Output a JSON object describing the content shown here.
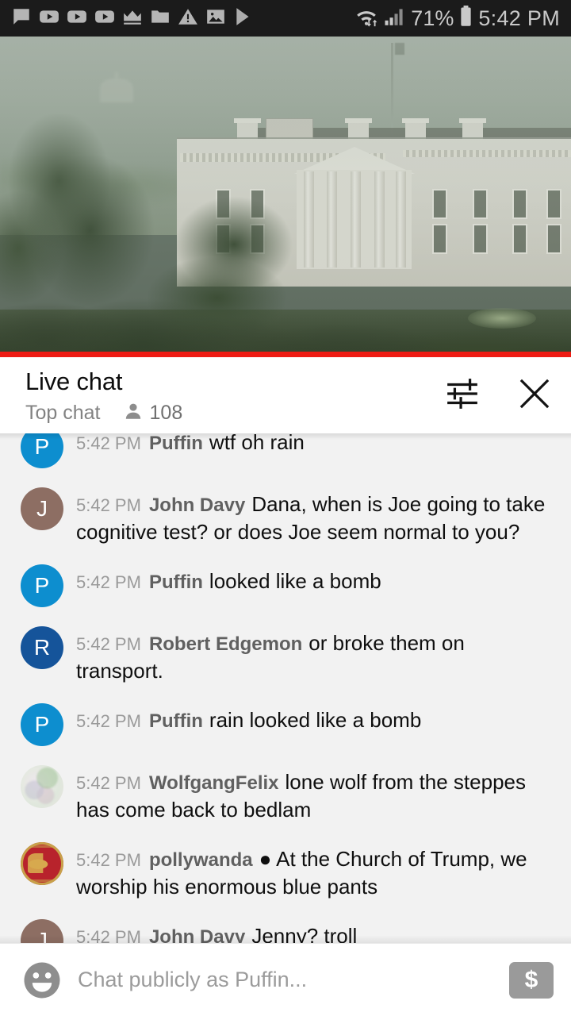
{
  "status_bar": {
    "icons_left": [
      "chat-bubble-icon",
      "youtube-icon",
      "youtube-icon",
      "youtube-icon",
      "crown-icon",
      "folder-icon",
      "warning-triangle-icon",
      "image-icon",
      "play-store-icon"
    ],
    "wifi_icon": "wifi-transfer-icon",
    "signal_icon": "cellular-signal-icon",
    "battery_percent": "71%",
    "battery_icon": "battery-icon",
    "clock": "5:42 PM",
    "background_color": "#1b1b1b",
    "foreground_color": "#c9c9c9"
  },
  "video": {
    "description": "White House live stream in hazy rain",
    "progress_bar_color": "#ee1b13",
    "progress_percent": 100
  },
  "chat_header": {
    "title": "Live chat",
    "mode": "Top chat",
    "viewer_count": "108",
    "viewer_icon": "person-icon",
    "settings_icon": "chat-settings-sliders-icon",
    "close_icon": "close-x-icon"
  },
  "messages": [
    {
      "time": "5:42 PM",
      "author": "Puffin",
      "text": "wtf oh rain",
      "avatar_type": "letter",
      "avatar_letter": "P",
      "avatar_color": "#0d8ecf",
      "clipped": true
    },
    {
      "time": "5:42 PM",
      "author": "John Davy",
      "text": "Dana, when is Joe going to take cognitive test? or does Joe seem normal to you?",
      "avatar_type": "letter",
      "avatar_letter": "J",
      "avatar_color": "#8d6e63"
    },
    {
      "time": "5:42 PM",
      "author": "Puffin",
      "text": "looked like a bomb",
      "avatar_type": "letter",
      "avatar_letter": "P",
      "avatar_color": "#0d8ecf"
    },
    {
      "time": "5:42 PM",
      "author": "Robert Edgemon",
      "text": "or broke them on transport.",
      "avatar_type": "letter",
      "avatar_letter": "R",
      "avatar_color": "#15549a"
    },
    {
      "time": "5:42 PM",
      "author": "Puffin",
      "text": "rain looked like a bomb",
      "avatar_type": "letter",
      "avatar_letter": "P",
      "avatar_color": "#0d8ecf"
    },
    {
      "time": "5:42 PM",
      "author": "WolfgangFelix",
      "text": "lone wolf from the steppes has come back to bedlam",
      "avatar_type": "photo",
      "avatar_class": "av-photo-wolf",
      "avatar_letter": ""
    },
    {
      "time": "5:42 PM",
      "author": "pollywanda",
      "text": "● At the Church of Trump, we worship his enormous blue pants",
      "avatar_type": "photo",
      "avatar_class": "av-photo-polly",
      "avatar_letter": ""
    },
    {
      "time": "5:42 PM",
      "author": "John Davy",
      "text": "Jenny? troll",
      "avatar_type": "letter",
      "avatar_letter": "J",
      "avatar_color": "#8d6e63"
    }
  ],
  "input_bar": {
    "emoji_icon": "emoji-smiley-icon",
    "placeholder": "Chat publicly as Puffin...",
    "value": "",
    "superchat_icon": "dollar-sign-icon",
    "superchat_symbol": "$"
  }
}
